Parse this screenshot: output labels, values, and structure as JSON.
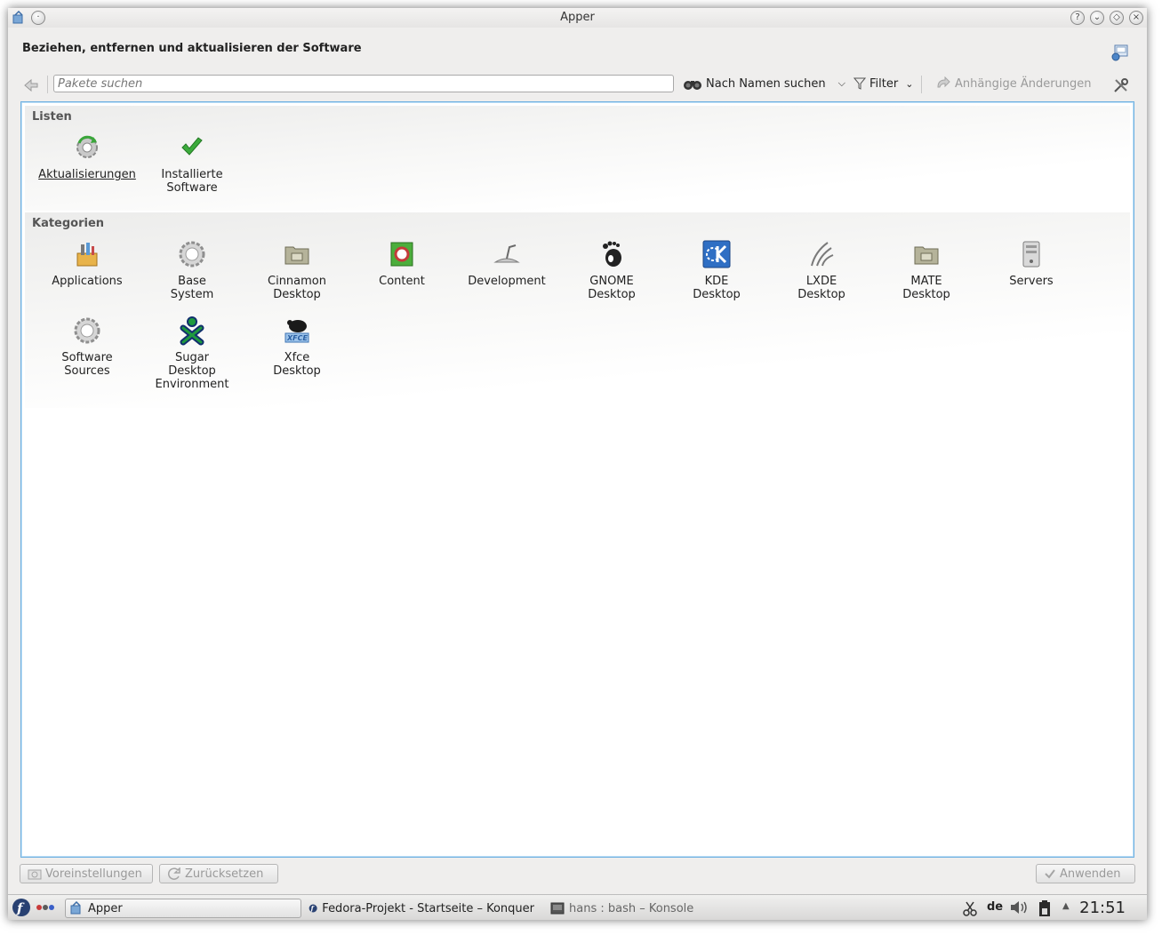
{
  "window": {
    "title": "Apper",
    "controls": [
      "help",
      "minimize",
      "maximize",
      "close"
    ]
  },
  "header": {
    "title": "Beziehen, entfernen und aktualisieren der Software"
  },
  "toolbar": {
    "search_placeholder": "Pakete suchen",
    "search_mode_label": "Nach Namen suchen",
    "filter_label": "Filter",
    "pending_label": "Anhängige Änderungen"
  },
  "lists": {
    "title": "Listen",
    "items": [
      {
        "label": "Aktualisierungen",
        "icon": "updates-icon"
      },
      {
        "label": "Installierte\nSoftware",
        "icon": "installed-check-icon"
      }
    ]
  },
  "categories": {
    "title": "Kategorien",
    "items": [
      {
        "label": "Applications",
        "icon": "applications-icon"
      },
      {
        "label": "Base\nSystem",
        "icon": "gear-icon"
      },
      {
        "label": "Cinnamon\nDesktop",
        "icon": "folder-icon"
      },
      {
        "label": "Content",
        "icon": "content-icon"
      },
      {
        "label": "Development",
        "icon": "development-icon"
      },
      {
        "label": "GNOME\nDesktop",
        "icon": "gnome-foot-icon"
      },
      {
        "label": "KDE\nDesktop",
        "icon": "kde-logo-icon"
      },
      {
        "label": "LXDE\nDesktop",
        "icon": "lxde-icon"
      },
      {
        "label": "MATE\nDesktop",
        "icon": "folder-icon"
      },
      {
        "label": "Servers",
        "icon": "server-icon"
      },
      {
        "label": "Software\nSources",
        "icon": "gear-icon"
      },
      {
        "label": "Sugar\nDesktop\nEnvironment",
        "icon": "sugar-icon"
      },
      {
        "label": "Xfce\nDesktop",
        "icon": "xfce-mouse-icon"
      }
    ]
  },
  "footer": {
    "defaults_label": "Voreinstellungen",
    "reset_label": "Zurücksetzen",
    "apply_label": "Anwenden"
  },
  "taskbar": {
    "tasks": [
      {
        "label": "Apper"
      },
      {
        "label": "Fedora-Projekt - Startseite – Konquer"
      },
      {
        "label": "hans : bash – Konsole"
      }
    ],
    "keyboard_layout": "de",
    "clock": "21:51"
  },
  "colors": {
    "accent_border": "#6fb0e0",
    "window_bg": "#efeeed"
  }
}
